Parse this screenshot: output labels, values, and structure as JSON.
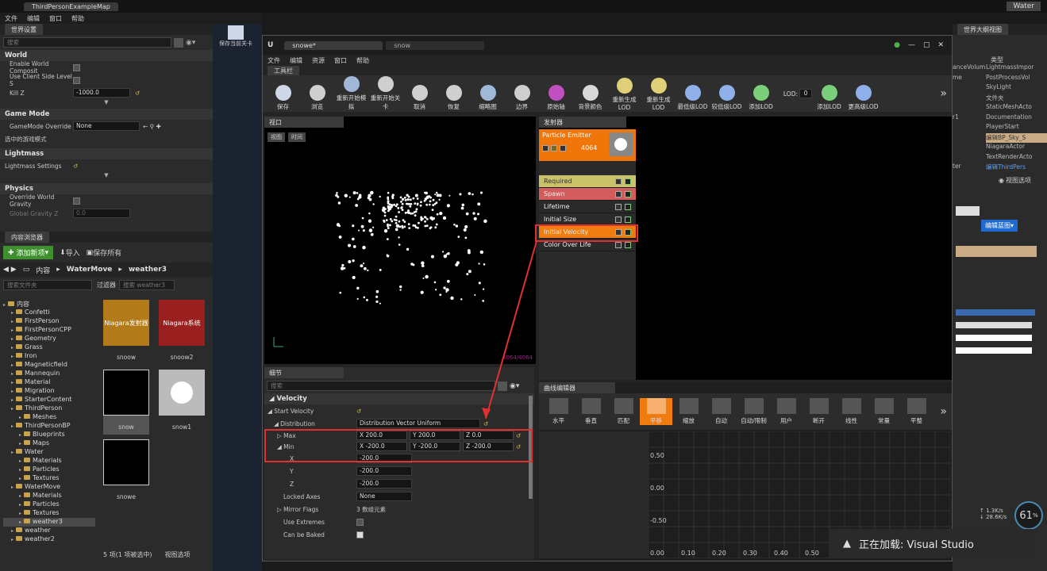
{
  "editor": {
    "tab": "ThirdPersonExampleMap",
    "search_right": "Water",
    "menu": [
      "文件",
      "编辑",
      "窗口",
      "帮助"
    ],
    "save_current": "保存当前关卡"
  },
  "world_settings": {
    "title": "世界设置",
    "search": "搜索",
    "sections": {
      "world": "World",
      "gamemode": "Game Mode",
      "lightmass": "Lightmass",
      "physics": "Physics"
    },
    "props": {
      "enable_world": "Enable World Composit",
      "client_side": "Use Client Side Level S",
      "kill_z": "Kill Z",
      "kill_z_value": "-1000.0",
      "gm_override": "GameMode Override",
      "gm_value": "None",
      "selected_gm": "选中的游戏模式",
      "lm_settings": "Lightmass Settings",
      "override_gravity": "Override World Gravity",
      "global_gravity": "Global Gravity Z",
      "global_gravity_value": "0.0"
    }
  },
  "content_browser": {
    "title": "内容浏览器",
    "add_new": "添加新项",
    "import": "导入",
    "save_all": "保存所有",
    "path": [
      "内容",
      "WaterMove",
      "weather3"
    ],
    "search_folders": "搜索文件夹",
    "filters": "过滤器",
    "search_assets": "搜索 weather3",
    "tree": [
      {
        "label": "内容",
        "lvl": 0
      },
      {
        "label": "Confetti",
        "lvl": 1
      },
      {
        "label": "FirstPerson",
        "lvl": 1
      },
      {
        "label": "FirstPersonCPP",
        "lvl": 1
      },
      {
        "label": "Geometry",
        "lvl": 1
      },
      {
        "label": "Grass",
        "lvl": 1
      },
      {
        "label": "Iron",
        "lvl": 1
      },
      {
        "label": "Magneticfield",
        "lvl": 1
      },
      {
        "label": "Mannequin",
        "lvl": 1
      },
      {
        "label": "Material",
        "lvl": 1
      },
      {
        "label": "Migration",
        "lvl": 1
      },
      {
        "label": "StarterContent",
        "lvl": 1
      },
      {
        "label": "ThirdPerson",
        "lvl": 1
      },
      {
        "label": "Meshes",
        "lvl": 2
      },
      {
        "label": "ThirdPersonBP",
        "lvl": 1
      },
      {
        "label": "Blueprints",
        "lvl": 2
      },
      {
        "label": "Maps",
        "lvl": 2
      },
      {
        "label": "Water",
        "lvl": 1
      },
      {
        "label": "Materials",
        "lvl": 2
      },
      {
        "label": "Particles",
        "lvl": 2
      },
      {
        "label": "Textures",
        "lvl": 2
      },
      {
        "label": "WaterMove",
        "lvl": 1
      },
      {
        "label": "Materials",
        "lvl": 2
      },
      {
        "label": "Particles",
        "lvl": 2
      },
      {
        "label": "Textures",
        "lvl": 2
      },
      {
        "label": "weather3",
        "lvl": 2
      },
      {
        "label": "weather",
        "lvl": 1
      },
      {
        "label": "weather2",
        "lvl": 1
      }
    ],
    "assets": [
      {
        "name": "snoow",
        "thumb": "Niagara发射器"
      },
      {
        "name": "snoow2",
        "thumb": "Niagara系统"
      },
      {
        "name": "snow",
        "thumb": ""
      },
      {
        "name": "snow1",
        "thumb": ""
      },
      {
        "name": "snowe",
        "thumb": ""
      }
    ],
    "status": "5 项(1 项被选中)",
    "view_options": "视图选项"
  },
  "cascade": {
    "tabs": [
      "snowe*",
      "snow"
    ],
    "menu": [
      "文件",
      "编辑",
      "资源",
      "窗口",
      "帮助"
    ],
    "toolbar_title": "工具栏",
    "tools": [
      {
        "label": "保存",
        "color": "#cfd8e8"
      },
      {
        "label": "浏览",
        "color": "#cfcfcf"
      },
      {
        "label": "重新开始模拟",
        "color": "#9fb8d8"
      },
      {
        "label": "重新开始关卡",
        "color": "#cfcfcf"
      },
      {
        "label": "取消",
        "color": "#cfcfcf"
      },
      {
        "label": "恢复",
        "color": "#cfcfcf"
      },
      {
        "label": "缩略图",
        "color": "#9fb8d8"
      },
      {
        "label": "边界",
        "color": "#cfcfcf"
      },
      {
        "label": "原始轴",
        "color": "#c050c0"
      },
      {
        "label": "背景颜色",
        "color": "#d8d8d8"
      },
      {
        "label": "重新生成LOD",
        "color": "#e0d07a"
      },
      {
        "label": "重新生成LOD",
        "color": "#e0d07a"
      },
      {
        "label": "最低级LOD",
        "color": "#8fb0e8"
      },
      {
        "label": "较低级LOD",
        "color": "#8fb0e8"
      },
      {
        "label": "添加LOD",
        "color": "#7ad07a"
      },
      {
        "label": "LOD:",
        "color": "#cfcfcf"
      },
      {
        "label": "添加LOD",
        "color": "#7ad07a"
      },
      {
        "label": "更高级LOD",
        "color": "#8fb0e8"
      }
    ],
    "lod_value": "0",
    "viewport": {
      "title": "视口",
      "btn_view": "视图",
      "btn_time": "时间",
      "count": "4064/4064"
    },
    "emitters": {
      "title": "发射器",
      "name": "Particle Emitter",
      "count": "4064",
      "modules": [
        "Required",
        "Spawn",
        "Lifetime",
        "Initial Size",
        "Initial Velocity",
        "Color Over Life"
      ]
    },
    "details": {
      "title": "细节",
      "search": "搜索",
      "section": "Velocity",
      "start_velocity": "Start Velocity",
      "distribution": "Distribution",
      "dist_value": "Distribution Vector Uniform",
      "max": "Max",
      "min": "Min",
      "max_vals": {
        "x": "200.0",
        "y": "200.0",
        "z": "0.0"
      },
      "min_vals": {
        "x": "-200.0",
        "y": "-200.0",
        "z": "-200.0"
      },
      "sub_x": "X",
      "sub_y": "Y",
      "sub_z": "Z",
      "sub_x_val": "-200.0",
      "sub_y_val": "-200.0",
      "sub_z_val": "-200.0",
      "locked_axes": "Locked Axes",
      "locked_value": "None",
      "mirror_flags": "Mirror Flags",
      "mirror_value": "3 数组元素",
      "use_extremes": "Use Extremes",
      "can_be_baked": "Can be Baked"
    },
    "curve_editor": {
      "title": "曲线编辑器",
      "tools": [
        "水平",
        "垂直",
        "匹配",
        "平移",
        "缩放",
        "自动",
        "自动/限制",
        "用户",
        "断开",
        "线性",
        "常量",
        "平整"
      ],
      "y_labels": [
        "0.50",
        "0.00",
        "-0.50"
      ],
      "x_labels": [
        "0.00",
        "0.10",
        "0.20",
        "0.30",
        "0.40",
        "0.50"
      ]
    }
  },
  "outliner": {
    "title": "世界大纲视图",
    "type_header": "类型",
    "types": [
      "LightmassImpor",
      "PostProcessVol",
      "SkyLight",
      "文件夹",
      "StaticMeshActo",
      "Documentation",
      "PlayerStart",
      "编辑BP_Sky_S",
      "NiagaraActor",
      "TextRenderActo",
      "编辑ThirdPers"
    ],
    "left_frag": [
      "anceVolum",
      "me",
      "r1",
      "ter"
    ],
    "view_options": "视图选项",
    "edit_bp": "编辑蓝图"
  },
  "stats": {
    "up": "1.3",
    "down": "28.6",
    "unit": "K/s",
    "percent": "61",
    "pct": "%"
  },
  "toast": "正在加载: Visual Studio",
  "colors": {
    "orange": "#f07b0f",
    "red_box": "#e03030",
    "emitter_bg": "#f0760a",
    "required": "#c8c26a",
    "spawn": "#d35c5c"
  }
}
